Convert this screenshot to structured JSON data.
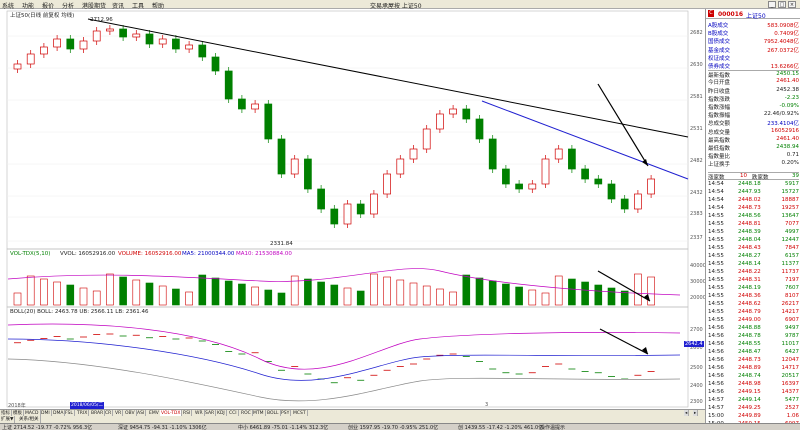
{
  "menu": {
    "items": [
      "系统",
      "功能",
      "报价",
      "分析",
      "港股期货",
      "资讯",
      "工具",
      "帮助"
    ],
    "title": "交易承屋按   上证50"
  },
  "main_chart": {
    "title": "上证50(日线 前复权 均线)",
    "top_label": "2712.96",
    "low_label": "2331.84",
    "y_ticks": [
      "2682",
      "2630",
      "2581",
      "2531",
      "2482",
      "2432",
      "2383",
      "2337"
    ],
    "colors": {
      "up": "#d00000",
      "down": "#008000",
      "trend1": "#000000",
      "trend2": "#2020d0"
    }
  },
  "volume_panel": {
    "title_prefix": "VOL-TDX(5,10)",
    "vvol": "VVOL: 16052916.00",
    "volume": "VOLUME: 16052916.00",
    "ma5": "MA5: 21000344.00",
    "ma10": "MA10: 21530884.00",
    "y_ticks": [
      "40000",
      "30000",
      "20000"
    ]
  },
  "boll_panel": {
    "title": "BOLL(20) BOLL: 2463.78  UB: 2566.11  LB: 2361.46",
    "y_ticks": [
      "2700",
      "2600",
      "2500",
      "2400",
      "2300"
    ],
    "side_badge": "2642.4"
  },
  "x_axis": {
    "left_label": "2018年",
    "marker_label": "3",
    "highlight": "2018/06/05/二"
  },
  "indicator_tabs": [
    "指标",
    "模板",
    "MACD",
    "DMI",
    "DMA",
    "FSL",
    "TRIX",
    "BRAR",
    "CR",
    "VR",
    "OBV",
    "ASI",
    "EMV",
    "VOL-TDX",
    "RSI",
    "WR",
    "SAR",
    "KDJ",
    "CCI",
    "ROC",
    "MTM",
    "BOLL",
    "PSY",
    "MCST"
  ],
  "sub_tabs": [
    "扩展▼",
    "关系/相关"
  ],
  "quote": {
    "code": "000016",
    "name": "上证50",
    "rows": [
      {
        "k": "A股成交",
        "v": "583.0908亿",
        "c": "red"
      },
      {
        "k": "B股成交",
        "v": "0.7409亿",
        "c": "red"
      },
      {
        "k": "国债成交",
        "v": "7952.4048亿",
        "c": "red"
      },
      {
        "k": "基金成交",
        "v": "267.0372亿",
        "c": "red"
      },
      {
        "k": "权证成交",
        "v": "",
        "c": "red"
      },
      {
        "k": "债券成交",
        "v": "13.6266亿",
        "c": "red"
      },
      {
        "k": "最新指数",
        "v": "2450.15",
        "c": "green"
      },
      {
        "k": "今日开盘",
        "v": "2461.40",
        "c": "red"
      },
      {
        "k": "昨日收盘",
        "v": "2452.38",
        "c": "black"
      },
      {
        "k": "指数涨跌",
        "v": "-2.23",
        "c": "green"
      },
      {
        "k": "指数涨幅",
        "v": "-0.09%",
        "c": "green"
      },
      {
        "k": "指数振幅",
        "v": "22.46/0.92%",
        "c": "black"
      },
      {
        "k": "总成交额",
        "v": "233.4104亿",
        "c": "blue"
      },
      {
        "k": "总成交量",
        "v": "16052916",
        "c": "red"
      },
      {
        "k": "最高指数",
        "v": "2461.40",
        "c": "red"
      },
      {
        "k": "最低指数",
        "v": "2438.94",
        "c": "green"
      },
      {
        "k": "指数量比",
        "v": "0.71",
        "c": "black"
      },
      {
        "k": "上证换手",
        "v": "0.20%",
        "c": "black"
      }
    ],
    "updown": {
      "label_up": "涨家数",
      "up": "10",
      "label_down": "跌家数",
      "down": "39"
    }
  },
  "ticks": [
    {
      "t": "14:54",
      "p": "2448.18",
      "v": "5917",
      "c": "green"
    },
    {
      "t": "14:54",
      "p": "2447.93",
      "v": "15727",
      "c": "green"
    },
    {
      "t": "14:54",
      "p": "2448.02",
      "v": "18887",
      "c": "red"
    },
    {
      "t": "14:54",
      "p": "2448.73",
      "v": "19257",
      "c": "red"
    },
    {
      "t": "14:55",
      "p": "2448.56",
      "v": "13647",
      "c": "green"
    },
    {
      "t": "14:55",
      "p": "2448.81",
      "v": "7077",
      "c": "red"
    },
    {
      "t": "14:55",
      "p": "2448.39",
      "v": "4997",
      "c": "green"
    },
    {
      "t": "14:55",
      "p": "2448.04",
      "v": "12447",
      "c": "green"
    },
    {
      "t": "14:55",
      "p": "2448.43",
      "v": "7847",
      "c": "red"
    },
    {
      "t": "14:55",
      "p": "2448.27",
      "v": "6157",
      "c": "green"
    },
    {
      "t": "14:55",
      "p": "2448.14",
      "v": "11377",
      "c": "green"
    },
    {
      "t": "14:55",
      "p": "2448.22",
      "v": "11737",
      "c": "red"
    },
    {
      "t": "14:55",
      "p": "2448.31",
      "v": "7197",
      "c": "red"
    },
    {
      "t": "14:55",
      "p": "2448.19",
      "v": "7607",
      "c": "green"
    },
    {
      "t": "14:55",
      "p": "2448.36",
      "v": "8107",
      "c": "red"
    },
    {
      "t": "14:55",
      "p": "2448.62",
      "v": "26217",
      "c": "red"
    },
    {
      "t": "14:55",
      "p": "2448.79",
      "v": "14217",
      "c": "red"
    },
    {
      "t": "14:55",
      "p": "2449.00",
      "v": "6907",
      "c": "red"
    },
    {
      "t": "14:56",
      "p": "2448.88",
      "v": "9497",
      "c": "green"
    },
    {
      "t": "14:56",
      "p": "2448.78",
      "v": "9787",
      "c": "green"
    },
    {
      "t": "14:56",
      "p": "2448.55",
      "v": "11017",
      "c": "green"
    },
    {
      "t": "14:56",
      "p": "2448.47",
      "v": "6427",
      "c": "green"
    },
    {
      "t": "14:56",
      "p": "2448.73",
      "v": "12047",
      "c": "red"
    },
    {
      "t": "14:56",
      "p": "2448.89",
      "v": "14717",
      "c": "red"
    },
    {
      "t": "14:56",
      "p": "2448.74",
      "v": "20517",
      "c": "green"
    },
    {
      "t": "14:56",
      "p": "2448.98",
      "v": "16397",
      "c": "red"
    },
    {
      "t": "14:56",
      "p": "2449.15",
      "v": "14377",
      "c": "red"
    },
    {
      "t": "14:57",
      "p": "2449.14",
      "v": "5477",
      "c": "green"
    },
    {
      "t": "14:57",
      "p": "2449.25",
      "v": "2527",
      "c": "red"
    },
    {
      "t": "15:00",
      "p": "2449.89",
      "v": "1.06",
      "c": "red"
    },
    {
      "t": "15:00",
      "p": "2450.15",
      "v": "6097",
      "c": "red"
    }
  ],
  "status": {
    "items": [
      "上证 2714.52  -19.77  -0.72%  956.3亿",
      "深证 9454.75  -94.31  -1.10%  1306亿",
      "中小 6461.89  -75.01  -1.14%  312.3亿",
      "创业 1597.95  -19.70  -0.95%  251.0亿",
      "创 1439.55  -17.42  -1.20%  461.0亿",
      "操作温提示"
    ]
  }
}
